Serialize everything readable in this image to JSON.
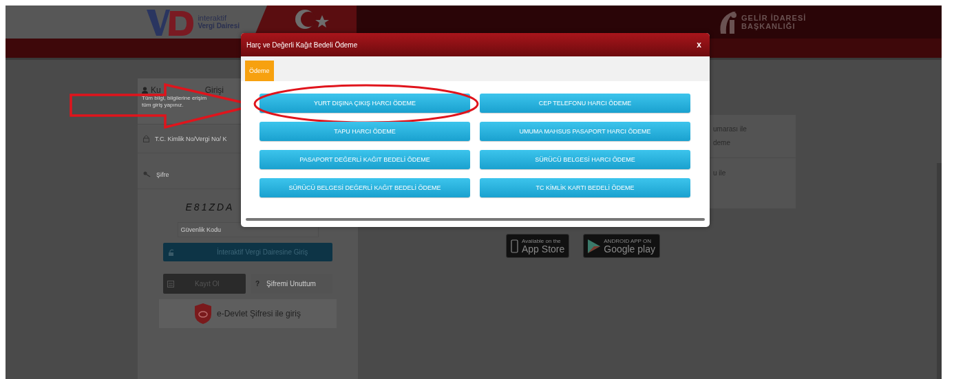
{
  "header": {
    "logo_lines": [
      "interaktif",
      "Vergi Dairesi"
    ],
    "brand_lines": [
      "GELİR İDARESİ",
      "BAŞKANLIĞI"
    ]
  },
  "login": {
    "title_parts": [
      "Ku",
      "Girişi"
    ],
    "description": [
      "Tüm bilgi, bilgilerine erişim",
      "tüm giriş yapınız."
    ],
    "id_placeholder": "T.C. Kimlik No/Vergi No/ K",
    "password_placeholder": "Şifre",
    "captcha": "E81ZDA",
    "security_placeholder": "Güvenlik Kodu",
    "login_button": "İnteraktif Vergi Dairesine Giriş",
    "register_button": "Kayıt Ol",
    "forgot_icon": "?",
    "forgot_button": "Şifremi Unuttum",
    "edevlet_button": "e-Devlet Şifresi ile giriş"
  },
  "info_rows": [
    [
      "umarası ile",
      "deme"
    ],
    [
      "u ile"
    ]
  ],
  "store_badges": [
    {
      "kind": "apple",
      "small": "Available on the",
      "big": "App Store"
    },
    {
      "kind": "google",
      "small": "ANDROID APP ON",
      "big": "Google play"
    }
  ],
  "modal": {
    "title": "Harç ve Değerli Kağıt Bedeli Ödeme",
    "close": "x",
    "tabs": [
      {
        "label": "Ödeme",
        "selected": true
      }
    ],
    "buttons": [
      {
        "label": "YURT DIŞINA ÇIKIŞ HARCI ÖDEME",
        "highlighted": true
      },
      {
        "label": "CEP TELEFONU HARCI ÖDEME",
        "highlighted": false
      },
      {
        "label": "TAPU HARCI ÖDEME",
        "highlighted": false
      },
      {
        "label": "UMUMA MAHSUS PASAPORT HARCI ÖDEME",
        "highlighted": false
      },
      {
        "label": "PASAPORT DEĞERLİ KAĞIT BEDELİ ÖDEME",
        "highlighted": false
      },
      {
        "label": "SÜRÜCÜ BELGESİ HARCI ÖDEME",
        "highlighted": false
      },
      {
        "label": "SÜRÜCÜ BELGESİ DEĞERLİ KAĞIT BEDELİ ÖDEME",
        "highlighted": false
      },
      {
        "label": "TC KİMLİK KARTI BEDELİ ÖDEME",
        "highlighted": false
      }
    ]
  }
}
